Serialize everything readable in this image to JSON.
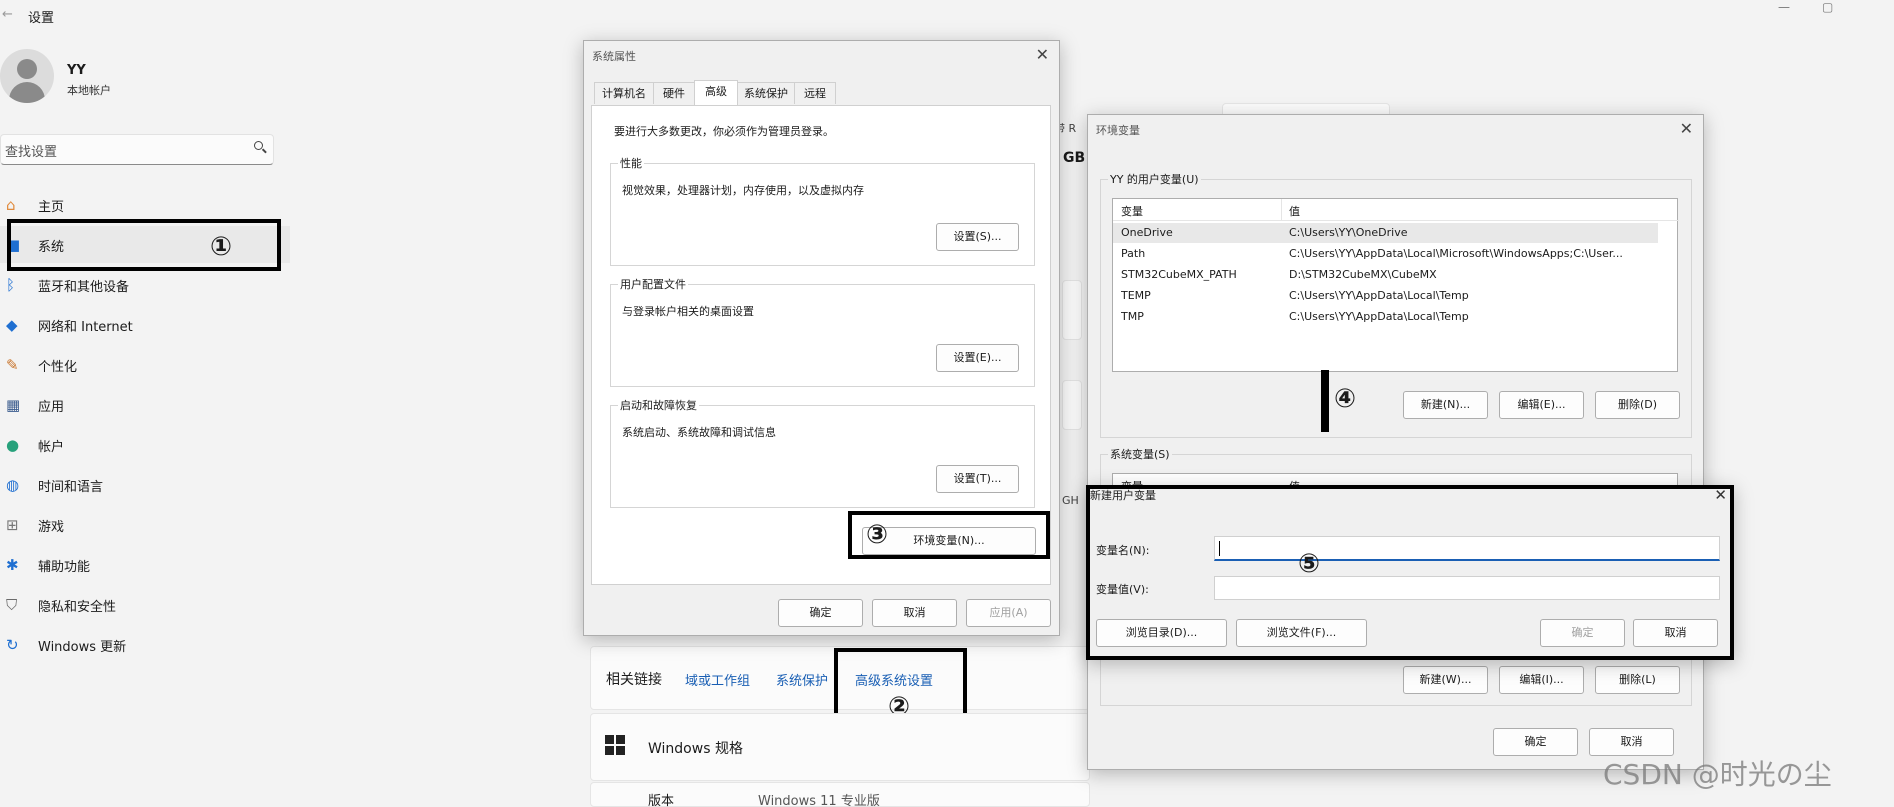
{
  "window": {
    "back_glyph": "←",
    "title": "设置",
    "min_glyph": "—",
    "max_glyph": "▢"
  },
  "user": {
    "name": "YY",
    "type": "本地帐户"
  },
  "search": {
    "placeholder": "查找设置"
  },
  "nav": [
    {
      "label": "主页",
      "icon": "home-icon"
    },
    {
      "label": "系统",
      "icon": "system-icon"
    },
    {
      "label": "蓝牙和其他设备",
      "icon": "bluetooth-icon"
    },
    {
      "label": "网络和 Internet",
      "icon": "wifi-icon"
    },
    {
      "label": "个性化",
      "icon": "brush-icon"
    },
    {
      "label": "应用",
      "icon": "apps-icon"
    },
    {
      "label": "帐户",
      "icon": "account-icon"
    },
    {
      "label": "时间和语言",
      "icon": "globe-clock-icon"
    },
    {
      "label": "游戏",
      "icon": "gamepad-icon"
    },
    {
      "label": "辅助功能",
      "icon": "accessibility-icon"
    },
    {
      "label": "隐私和安全性",
      "icon": "shield-icon"
    },
    {
      "label": "Windows 更新",
      "icon": "update-icon"
    }
  ],
  "background": {
    "ram_label": "带 R",
    "gb_label": "GB",
    "ghz_label": "GH",
    "related_links": {
      "title": "相关链接",
      "links": [
        "域或工作组",
        "系统保护",
        "高级系统设置"
      ]
    },
    "windows_spec": {
      "title": "Windows 规格",
      "version_label": "版本",
      "version_value": "Windows 11 专业版"
    }
  },
  "sysprops": {
    "title": "系统属性",
    "tabs": [
      "计算机名",
      "硬件",
      "高级",
      "系统保护",
      "远程"
    ],
    "active_tab": "高级",
    "admin_note": "要进行大多数更改，你必须作为管理员登录。",
    "groups": [
      {
        "title": "性能",
        "desc": "视觉效果，处理器计划，内存使用，以及虚拟内存",
        "button": "设置(S)..."
      },
      {
        "title": "用户配置文件",
        "desc": "与登录帐户相关的桌面设置",
        "button": "设置(E)..."
      },
      {
        "title": "启动和故障恢复",
        "desc": "系统启动、系统故障和调试信息",
        "button": "设置(T)..."
      }
    ],
    "env_button": "环境变量(N)...",
    "ok": "确定",
    "cancel": "取消",
    "apply": "应用(A)"
  },
  "envvars": {
    "title": "环境变量",
    "user_group": "YY 的用户变量(U)",
    "columns": [
      "变量",
      "值"
    ],
    "user_vars": [
      {
        "name": "OneDrive",
        "value": "C:\\Users\\YY\\OneDrive"
      },
      {
        "name": "Path",
        "value": "C:\\Users\\YY\\AppData\\Local\\Microsoft\\WindowsApps;C:\\User..."
      },
      {
        "name": "STM32CubeMX_PATH",
        "value": "D:\\STM32CubeMX\\CubeMX"
      },
      {
        "name": "TEMP",
        "value": "C:\\Users\\YY\\AppData\\Local\\Temp"
      },
      {
        "name": "TMP",
        "value": "C:\\Users\\YY\\AppData\\Local\\Temp"
      }
    ],
    "user_buttons": [
      "新建(N)...",
      "编辑(E)...",
      "删除(D)"
    ],
    "sys_group": "系统变量(S)",
    "sys_col_partial": [
      "变量",
      "值"
    ],
    "sys_buttons": [
      "新建(W)...",
      "编辑(I)...",
      "删除(L)"
    ],
    "ok": "确定",
    "cancel": "取消"
  },
  "newvar": {
    "title": "新建用户变量",
    "name_label": "变量名(N):",
    "value_label": "变量值(V):",
    "name_value": "",
    "value_value": "",
    "browse_dir": "浏览目录(D)...",
    "browse_file": "浏览文件(F)...",
    "ok": "确定",
    "cancel": "取消"
  },
  "markers": [
    "①",
    "②",
    "③",
    "④",
    "⑤"
  ],
  "watermark": "CSDN @时光の尘"
}
